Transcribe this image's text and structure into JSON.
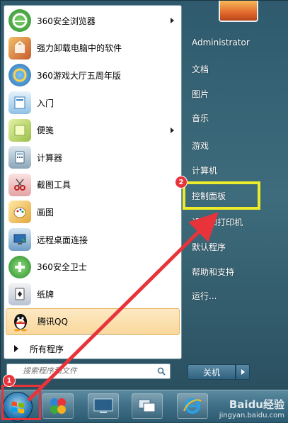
{
  "programs": [
    {
      "label": "360安全浏览器",
      "icon": "browser-360-icon",
      "color": "#3aa548",
      "has_submenu": true
    },
    {
      "label": "强力卸载电脑中的软件",
      "icon": "uninstaller-icon",
      "color": "#c65a2e",
      "has_submenu": false
    },
    {
      "label": "360游戏大厅五周年版",
      "icon": "game-hall-icon",
      "color": "#2a86d6",
      "has_submenu": false
    },
    {
      "label": "入门",
      "icon": "getting-started-icon",
      "color": "#5ba7d8",
      "has_submenu": false
    },
    {
      "label": "便笺",
      "icon": "sticky-notes-icon",
      "color": "#a6c95a",
      "has_submenu": true
    },
    {
      "label": "计算器",
      "icon": "calculator-icon",
      "color": "#6d8fa8",
      "has_submenu": false
    },
    {
      "label": "截图工具",
      "icon": "snipping-tool-icon",
      "color": "#d24a4a",
      "has_submenu": false
    },
    {
      "label": "画图",
      "icon": "paint-icon",
      "color": "#e3a63a",
      "has_submenu": false
    },
    {
      "label": "远程桌面连接",
      "icon": "remote-desktop-icon",
      "color": "#3a7fbf",
      "has_submenu": false
    },
    {
      "label": "360安全卫士",
      "icon": "security-guard-360-icon",
      "color": "#3cab3a",
      "has_submenu": false
    },
    {
      "label": "纸牌",
      "icon": "solitaire-icon",
      "color": "#4a6ea8",
      "has_submenu": false
    },
    {
      "label": "腾讯QQ",
      "icon": "qq-penguin-icon",
      "color": "#222222",
      "has_submenu": false
    }
  ],
  "all_programs_label": "所有程序",
  "search": {
    "placeholder": "搜索程序和文件"
  },
  "right_pane": {
    "user": "Administrator",
    "items": [
      "文档",
      "图片",
      "音乐",
      "游戏",
      "计算机",
      "控制面板",
      "设备和打印机",
      "默认程序",
      "帮助和支持",
      "运行..."
    ]
  },
  "shutdown_label": "关机",
  "annotations": {
    "step1": "1",
    "step2": "2"
  },
  "colors": {
    "annotation_red": "#e8333a",
    "annotation_yellow": "#ecec2a",
    "highlight": "#f9d89b"
  },
  "watermark": {
    "brand": "Baidu经验",
    "url": "jingyan.baidu.com"
  }
}
